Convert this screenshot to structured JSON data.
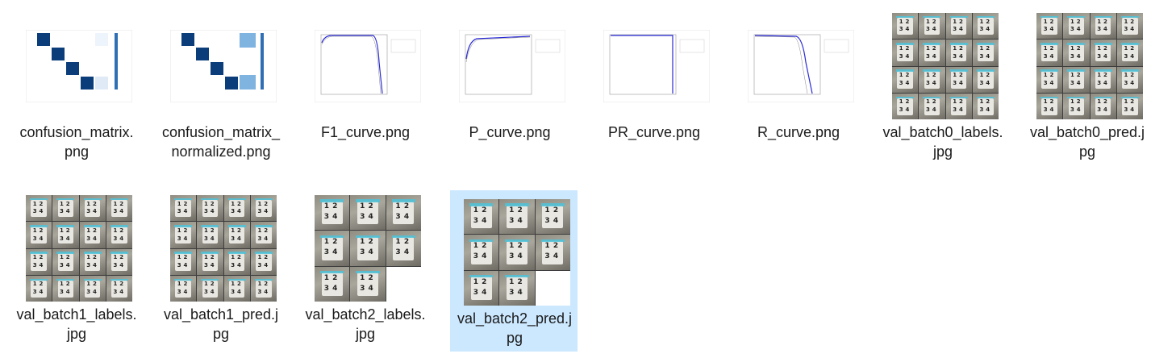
{
  "files": [
    {
      "name": "confusion_matrix.png"
    },
    {
      "name": "confusion_matrix_normalized.png"
    },
    {
      "name": "F1_curve.png"
    },
    {
      "name": "P_curve.png"
    },
    {
      "name": "PR_curve.png"
    },
    {
      "name": "R_curve.png"
    },
    {
      "name": "val_batch0_labels.jpg"
    },
    {
      "name": "val_batch0_pred.jpg"
    },
    {
      "name": "val_batch1_labels.jpg"
    },
    {
      "name": "val_batch1_pred.jpg"
    },
    {
      "name": "val_batch2_labels.jpg"
    },
    {
      "name": "val_batch2_pred.jpg"
    }
  ],
  "selected_file": "val_batch2_pred.jpg",
  "colors": {
    "selection": "#cce8ff",
    "matrix_dark": "#0b3d7a",
    "matrix_light": "#7fb3e0",
    "curve_line": "#2b2bd6",
    "bbox": "#4cc3d9"
  },
  "icons": [
    "confusion-matrix-thumbnail",
    "curve-chart-thumbnail",
    "image-grid-thumbnail"
  ]
}
